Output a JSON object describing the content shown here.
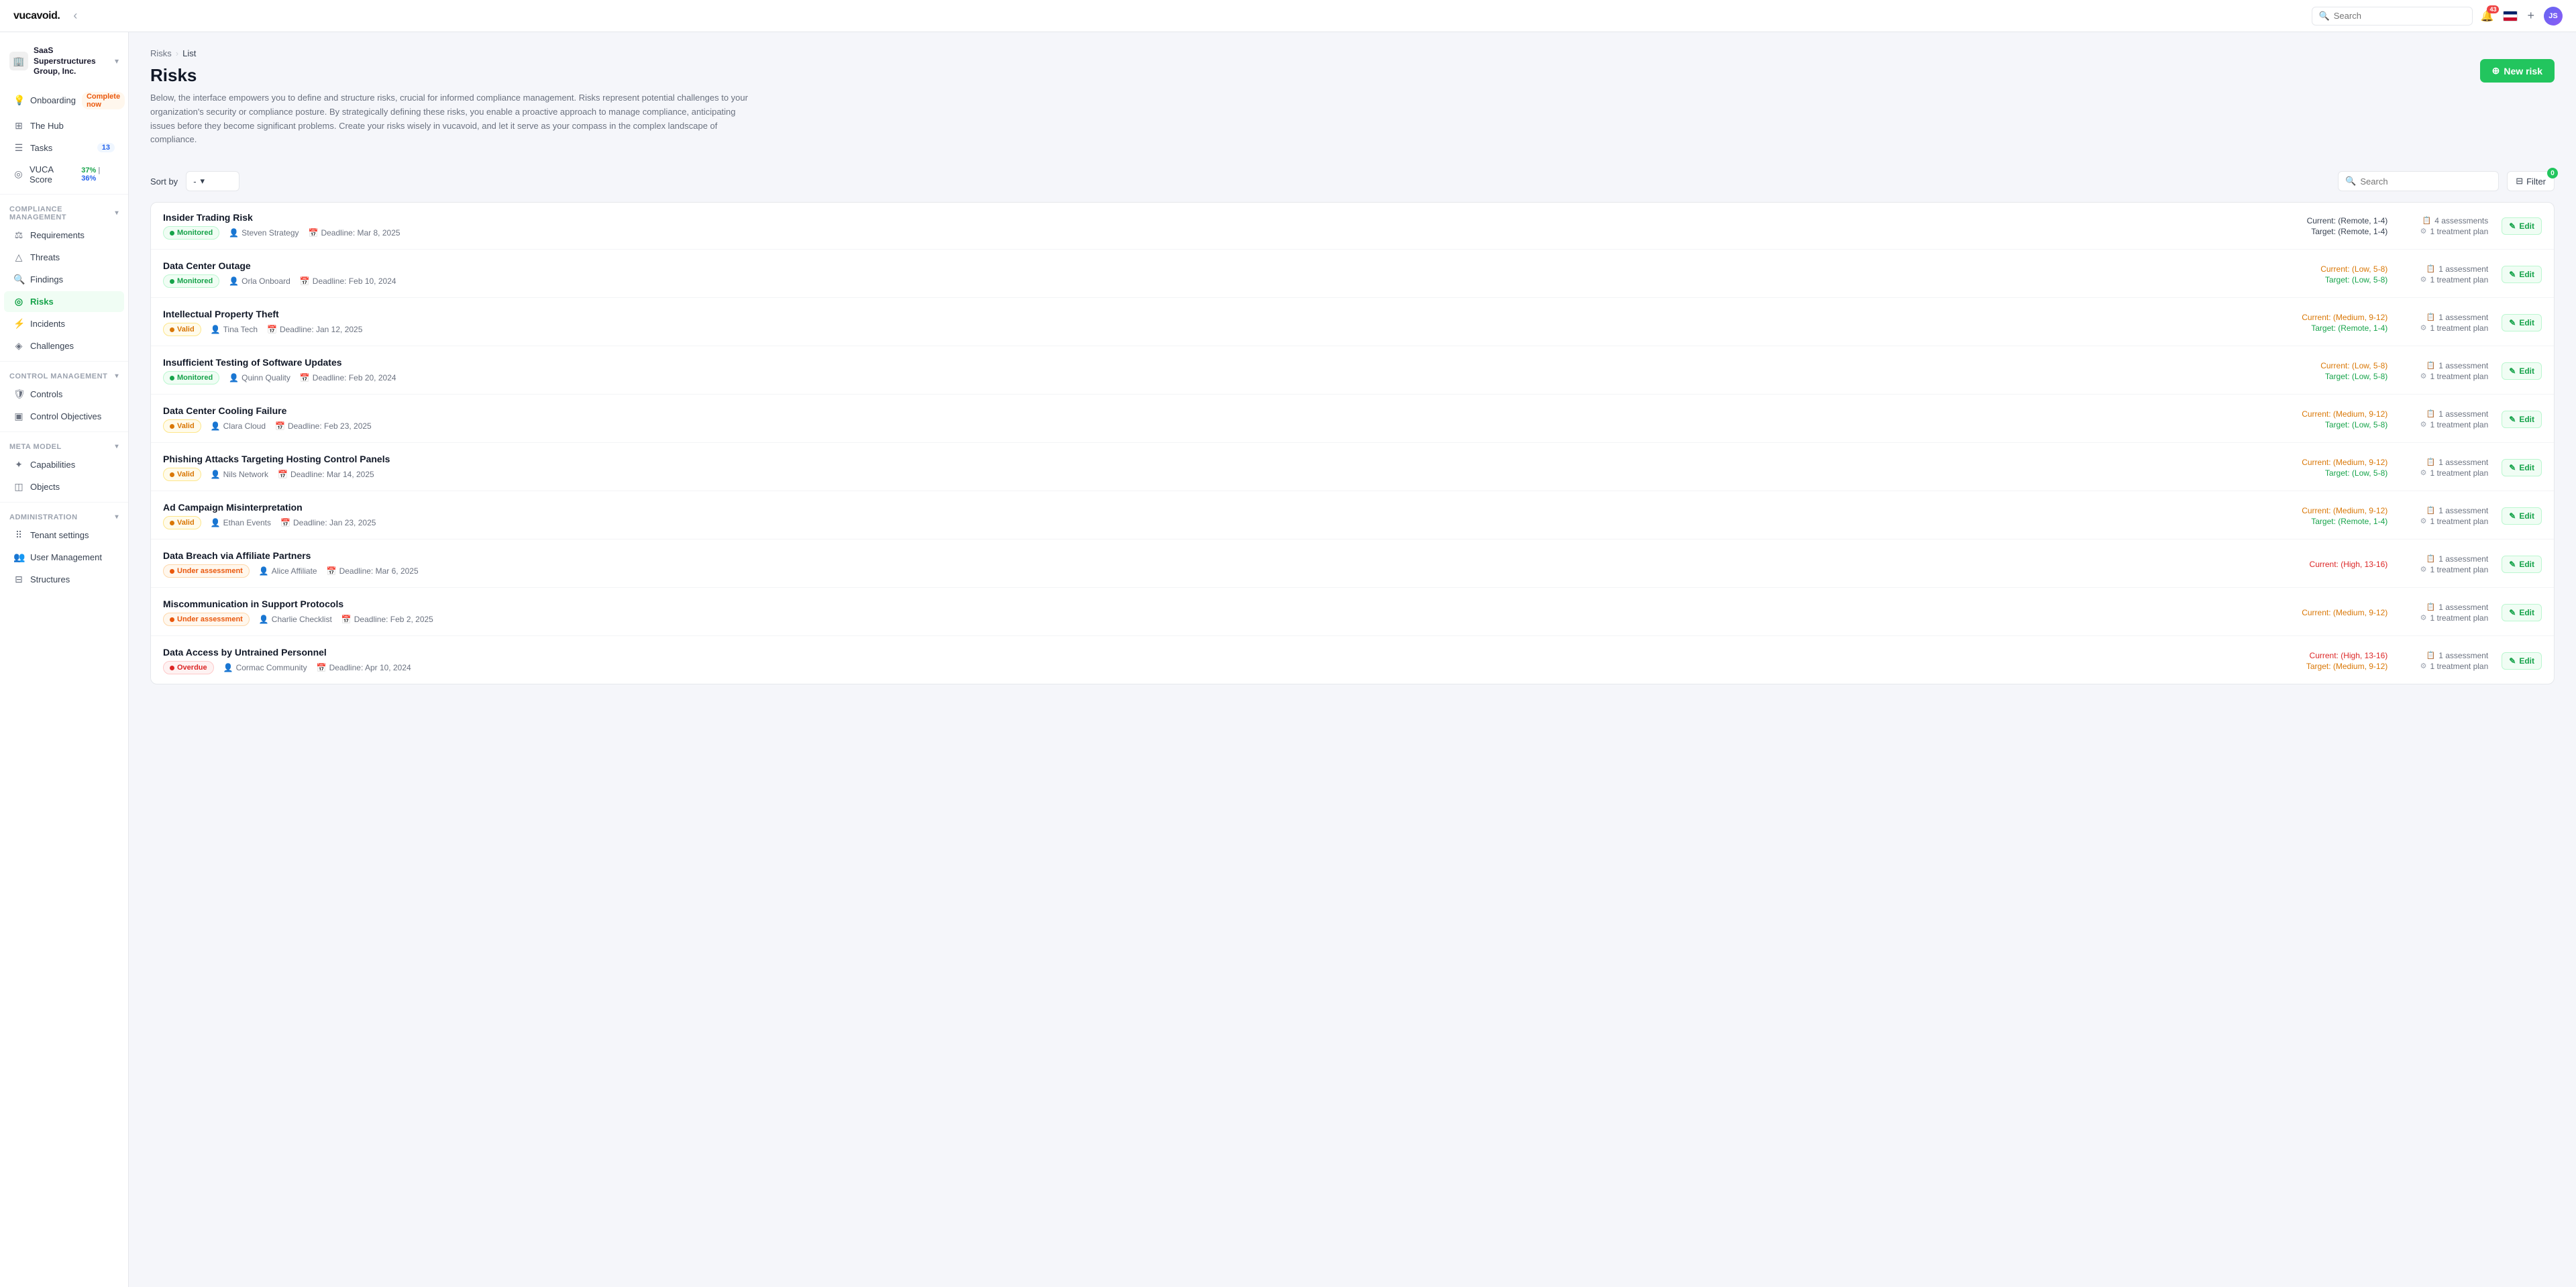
{
  "app": {
    "logo": "vucavoid.",
    "logo_dot": ".",
    "topbar_search_placeholder": "Search",
    "notification_count": "43",
    "avatar_initials": "JS",
    "plus_icon": "+",
    "back_icon": "‹"
  },
  "sidebar": {
    "org_name": "SaaS Superstructures Group, Inc.",
    "org_icon": "🏢",
    "nav_items": [
      {
        "label": "Onboarding",
        "icon": "💡",
        "badge": "Complete now",
        "badge_type": "orange",
        "id": "onboarding"
      },
      {
        "label": "The Hub",
        "icon": "⊞",
        "badge": "",
        "badge_type": "",
        "id": "hub"
      },
      {
        "label": "Tasks",
        "icon": "☰",
        "badge": "13",
        "badge_type": "tasks",
        "id": "tasks"
      },
      {
        "label": "VUCA Score",
        "icon": "◎",
        "score": "37% | 36%",
        "id": "vuca"
      }
    ],
    "compliance_section": "Compliance Management",
    "compliance_items": [
      {
        "label": "Requirements",
        "icon": "⚖",
        "id": "requirements"
      },
      {
        "label": "Threats",
        "icon": "△",
        "id": "threats"
      },
      {
        "label": "Findings",
        "icon": "🔍",
        "id": "findings"
      },
      {
        "label": "Risks",
        "icon": "◎",
        "id": "risks",
        "active": true
      },
      {
        "label": "Incidents",
        "icon": "⚡",
        "id": "incidents"
      },
      {
        "label": "Challenges",
        "icon": "◈",
        "id": "challenges"
      }
    ],
    "control_section": "Control Management",
    "control_items": [
      {
        "label": "Controls",
        "icon": "🛡",
        "id": "controls"
      },
      {
        "label": "Control Objectives",
        "icon": "▣",
        "id": "control-objectives"
      }
    ],
    "meta_section": "Meta Model",
    "meta_items": [
      {
        "label": "Capabilities",
        "icon": "✦",
        "id": "capabilities"
      },
      {
        "label": "Objects",
        "icon": "◫",
        "id": "objects"
      }
    ],
    "admin_section": "Administration",
    "admin_items": [
      {
        "label": "Tenant settings",
        "icon": "⠿",
        "id": "tenant-settings"
      },
      {
        "label": "User Management",
        "icon": "👥",
        "id": "user-management"
      },
      {
        "label": "Structures",
        "icon": "⊟",
        "id": "structures"
      }
    ]
  },
  "page": {
    "breadcrumb_parent": "Risks",
    "breadcrumb_sep": "›",
    "breadcrumb_current": "List",
    "title": "Risks",
    "description": "Below, the interface empowers you to define and structure risks, crucial for informed compliance management. Risks represent potential challenges to your organization's security or compliance posture. By strategically defining these risks, you enable a proactive approach to manage compliance, anticipating issues before they become significant problems. Create your risks wisely in vucavoid, and let it serve as your compass in the complex landscape of compliance.",
    "new_risk_label": "New risk",
    "sort_label": "Sort by",
    "sort_value": "-",
    "search_placeholder": "Search",
    "filter_label": "Filter",
    "filter_count": "0"
  },
  "risks": [
    {
      "name": "Insider Trading Risk",
      "status": "Monitored",
      "status_type": "monitored",
      "assignee": "Steven Strategy",
      "deadline": "Deadline: Mar 8, 2025",
      "current_score": "Current: (Remote, 1-4)",
      "current_type": "gray",
      "target_score": "Target: (Remote, 1-4)",
      "target_type": "gray",
      "assessments": "4 assessments",
      "treatment": "1 treatment plan"
    },
    {
      "name": "Data Center Outage",
      "status": "Monitored",
      "status_type": "monitored",
      "assignee": "Orla Onboard",
      "deadline": "Deadline: Feb 10, 2024",
      "current_score": "Current: (Low, 5-8)",
      "current_type": "orange",
      "target_score": "Target: (Low, 5-8)",
      "target_type": "green",
      "assessments": "1 assessment",
      "treatment": "1 treatment plan"
    },
    {
      "name": "Intellectual Property Theft",
      "status": "Valid",
      "status_type": "valid",
      "assignee": "Tina Tech",
      "deadline": "Deadline: Jan 12, 2025",
      "current_score": "Current: (Medium, 9-12)",
      "current_type": "orange",
      "target_score": "Target: (Remote, 1-4)",
      "target_type": "green",
      "assessments": "1 assessment",
      "treatment": "1 treatment plan"
    },
    {
      "name": "Insufficient Testing of Software Updates",
      "status": "Monitored",
      "status_type": "monitored",
      "assignee": "Quinn Quality",
      "deadline": "Deadline: Feb 20, 2024",
      "current_score": "Current: (Low, 5-8)",
      "current_type": "orange",
      "target_score": "Target: (Low, 5-8)",
      "target_type": "green",
      "assessments": "1 assessment",
      "treatment": "1 treatment plan"
    },
    {
      "name": "Data Center Cooling Failure",
      "status": "Valid",
      "status_type": "valid",
      "assignee": "Clara Cloud",
      "deadline": "Deadline: Feb 23, 2025",
      "current_score": "Current: (Medium, 9-12)",
      "current_type": "orange",
      "target_score": "Target: (Low, 5-8)",
      "target_type": "green",
      "assessments": "1 assessment",
      "treatment": "1 treatment plan"
    },
    {
      "name": "Phishing Attacks Targeting Hosting Control Panels",
      "status": "Valid",
      "status_type": "valid",
      "assignee": "Nils Network",
      "deadline": "Deadline: Mar 14, 2025",
      "current_score": "Current: (Medium, 9-12)",
      "current_type": "orange",
      "target_score": "Target: (Low, 5-8)",
      "target_type": "green",
      "assessments": "1 assessment",
      "treatment": "1 treatment plan"
    },
    {
      "name": "Ad Campaign Misinterpretation",
      "status": "Valid",
      "status_type": "valid",
      "assignee": "Ethan Events",
      "deadline": "Deadline: Jan 23, 2025",
      "current_score": "Current: (Medium, 9-12)",
      "current_type": "orange",
      "target_score": "Target: (Remote, 1-4)",
      "target_type": "green",
      "assessments": "1 assessment",
      "treatment": "1 treatment plan"
    },
    {
      "name": "Data Breach via Affiliate Partners",
      "status": "Under assessment",
      "status_type": "under",
      "assignee": "Alice Affiliate",
      "deadline": "Deadline: Mar 6, 2025",
      "current_score": "Current: (High, 13-16)",
      "current_type": "red",
      "target_score": "",
      "target_type": "",
      "assessments": "1 assessment",
      "treatment": "1 treatment plan"
    },
    {
      "name": "Miscommunication in Support Protocols",
      "status": "Under assessment",
      "status_type": "under",
      "assignee": "Charlie Checklist",
      "deadline": "Deadline: Feb 2, 2025",
      "current_score": "Current: (Medium, 9-12)",
      "current_type": "orange",
      "target_score": "",
      "target_type": "",
      "assessments": "1 assessment",
      "treatment": "1 treatment plan"
    },
    {
      "name": "Data Access by Untrained Personnel",
      "status": "Overdue",
      "status_type": "overdue",
      "assignee": "Cormac Community",
      "deadline": "Deadline: Apr 10, 2024",
      "current_score": "Current: (High, 13-16)",
      "current_type": "red",
      "target_score": "Target: (Medium, 9-12)",
      "target_type": "orange",
      "assessments": "1 assessment",
      "treatment": "1 treatment plan"
    }
  ],
  "labels": {
    "edit": "Edit",
    "assessments_icon": "📋",
    "treatment_icon": "⚙",
    "person_icon": "👤",
    "calendar_icon": "📅",
    "search_icon": "🔍",
    "filter_icon": "⊟",
    "plus_circle_icon": "⊕",
    "pencil_icon": "✎"
  }
}
